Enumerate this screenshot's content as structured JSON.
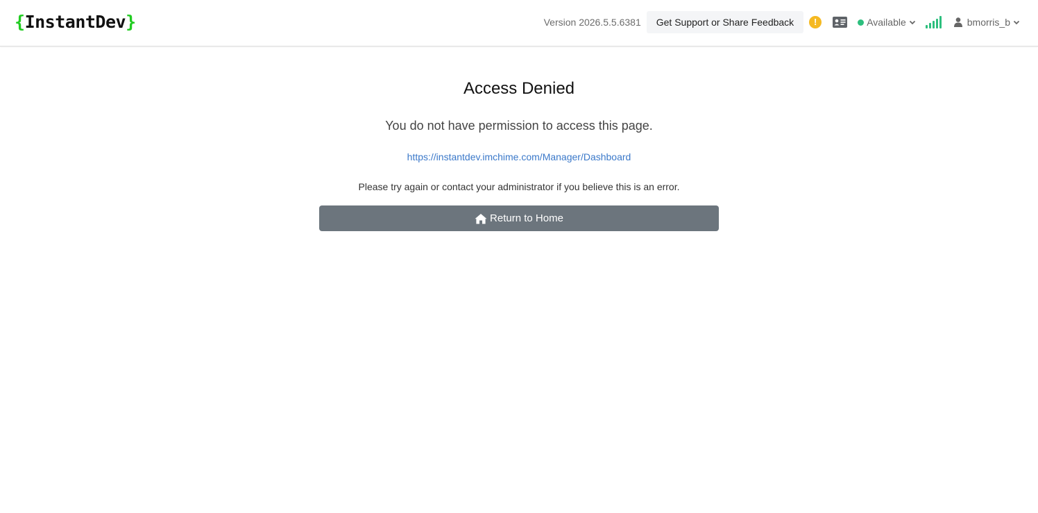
{
  "brand": {
    "open_brace": "{",
    "name": "InstantDev",
    "close_brace": "}"
  },
  "header": {
    "version": "Version 2026.5.5.6381",
    "support_button": "Get Support or Share Feedback",
    "warning_icon": "exclamation-circle-icon",
    "warning_glyph": "!",
    "card_icon": "id-card-icon",
    "status": "Available",
    "signal_icon": "signal-strength-icon",
    "username": "bmorris_b"
  },
  "main": {
    "title": "Access Denied",
    "message": "You do not have permission to access this page.",
    "url": "https://instantdev.imchime.com/Manager/Dashboard",
    "note": "Please try again or contact your administrator if you believe this is an error.",
    "home_button": "Return to Home"
  },
  "colors": {
    "brand_brace": "#22cc22",
    "status_green": "#2dbf7e",
    "warning": "#f5b921",
    "link": "#3a78c9",
    "button_gray": "#6c757d"
  }
}
